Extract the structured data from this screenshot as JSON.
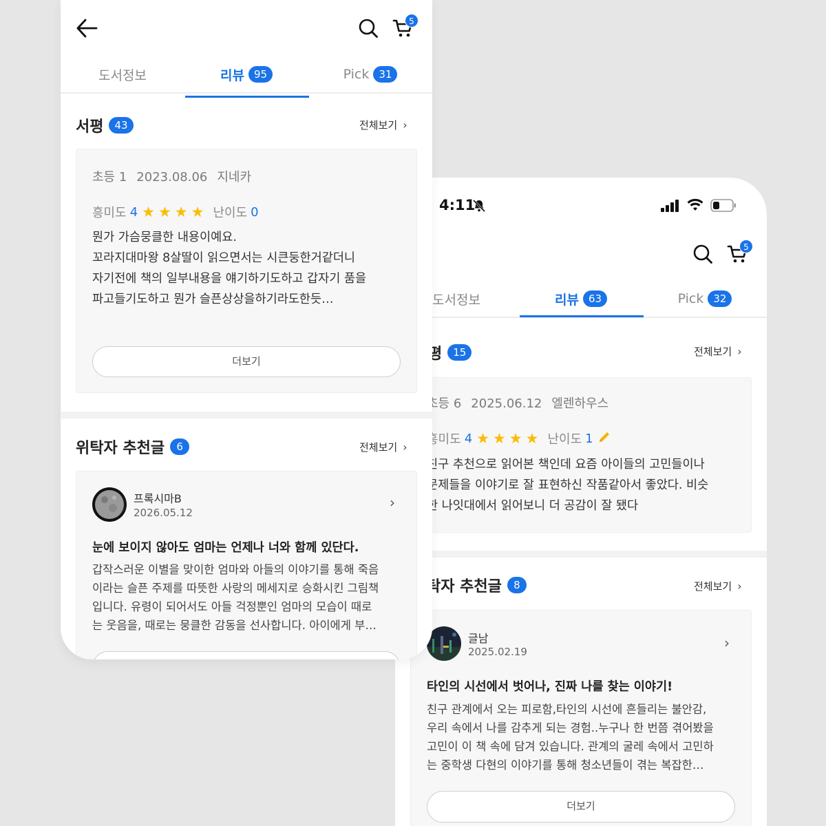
{
  "phone_a": {
    "header": {
      "back_icon": "arrow-left-icon",
      "search_icon": "search-icon",
      "cart_icon": "cart-icon",
      "cart_count": "5"
    },
    "tabs": [
      {
        "label": "도서정보",
        "count": ""
      },
      {
        "label": "리뷰",
        "count": "95"
      },
      {
        "label": "Pick",
        "count": "31"
      }
    ],
    "review_section": {
      "title": "서평",
      "count": "43",
      "see_all": "전체보기",
      "card": {
        "grade": "초등 1",
        "date": "2023.08.06",
        "author": "지네카",
        "fun_label": "흥미도",
        "fun_value": "4",
        "difficulty_label": "난이도",
        "difficulty_value": "0",
        "lines": [
          "뭔가 가슴뭉클한 내용이예요.",
          "꼬라지대마왕  8살딸이 읽으면서는 시큰둥한거같더니",
          "자기전에 책의 일부내용을 얘기하기도하고 갑자기 품을",
          "파고들기도하고  뭔가 슬픈상상을하기라도한듯…"
        ],
        "more": "더보기"
      }
    },
    "recommend_section": {
      "title": "위탁자 추천글",
      "count": "6",
      "see_all": "전체보기",
      "post": {
        "author": "프록시마B",
        "date": "2026.05.12",
        "title": "눈에 보이지 않아도 엄마는 언제나 너와 함께 있단다.",
        "lines": [
          "갑작스러운 이별을 맞이한 엄마와 아들의 이야기를 통해 죽음",
          "이라는 슬픈 주제를 따뜻한 사랑의 메세지로 승화시킨 그림책",
          "입니다. 유령이 되어서도 아들 걱정뿐인 엄마의 모습이 때로",
          "는 웃음을, 때로는 뭉클한 감동을 선사합니다. 아이에게 부…"
        ]
      }
    }
  },
  "phone_b": {
    "status_bar": {
      "time": "4:11"
    },
    "header": {
      "search_icon": "search-icon",
      "cart_icon": "cart-icon",
      "cart_count": "5"
    },
    "tabs": [
      {
        "label": "도서정보",
        "count": ""
      },
      {
        "label": "리뷰",
        "count": "63"
      },
      {
        "label": "Pick",
        "count": "32"
      }
    ],
    "review_section": {
      "title": "평",
      "count": "15",
      "see_all": "전체보기",
      "card": {
        "grade": "초등 6",
        "date": "2025.06.12",
        "author": "엘렌하우스",
        "fun_label": "흥미도",
        "fun_value": "4",
        "difficulty_label": "난이도",
        "difficulty_value": "1",
        "lines": [
          "친구 추천으로 읽어본 책인데 요즘 아이들의 고민들이나",
          "문제들을 이야기로 잘 표현하신 작품같아서 좋았다. 비슷",
          "한 나잇대에서 읽어보니 더 공감이 잘 됐다"
        ]
      }
    },
    "recommend_section": {
      "title": "탁자 추천글",
      "count": "8",
      "see_all": "전체보기",
      "post": {
        "author": "글남",
        "date": "2025.02.19",
        "title": "타인의 시선에서 벗어나, 진짜 나를 찾는 이야기!",
        "lines": [
          "친구 관계에서 오는 피로함,타인의 시선에 흔들리는 불안감,",
          "우리 속에서 나를 감추게 되는 경험..누구나 한 번쯤 겪어봤을",
          "고민이 이 책 속에 담겨 있습니다. 관계의 굴레 속에서 고민하",
          "는 중학생 다현의 이야기를 통해 청소년들이 겪는 복잡한…"
        ],
        "more": "더보기"
      }
    }
  },
  "colors": {
    "accent": "#1a73e8",
    "star": "#fbbc05",
    "pencil": "#f4b400"
  }
}
